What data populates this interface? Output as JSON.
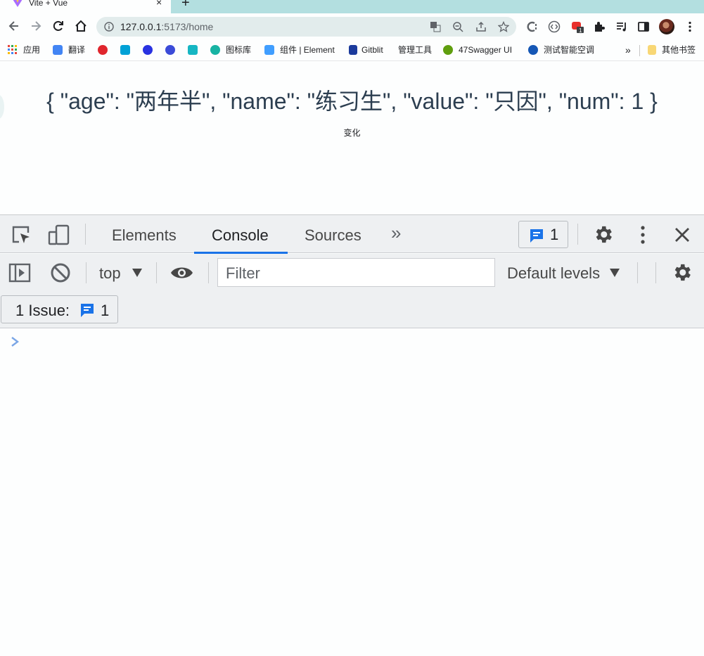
{
  "browser": {
    "tab": {
      "title": "Vite + Vue",
      "close": "×"
    },
    "new_tab": "+",
    "url": {
      "host": "127.0.0.1",
      "path": ":5173/home"
    }
  },
  "bookmarks": [
    {
      "label": "应用",
      "icon": "apps-grid-icon",
      "color": "#e8453c"
    },
    {
      "label": "翻译",
      "icon": "translate-icon",
      "color": "#4285f4"
    },
    {
      "label": "",
      "icon": "g-logo-icon",
      "color": "#e0262d"
    },
    {
      "label": "",
      "icon": "bilibili-icon",
      "color": "#00a1d6"
    },
    {
      "label": "",
      "icon": "baidu-paw-icon",
      "color": "#2932e1"
    },
    {
      "label": "",
      "icon": "search-q-icon",
      "color": "#3b4bd8"
    },
    {
      "label": "",
      "icon": "hex-logo-icon",
      "color": "#16b6c3"
    },
    {
      "label": "图标库",
      "icon": "iconfont-icon",
      "color": "#17b3a3"
    },
    {
      "label": "组件 | Element",
      "icon": "element-icon",
      "color": "#409eff"
    },
    {
      "label": "Gitblit",
      "icon": "gitblit-icon",
      "color": "#1b3a9c"
    },
    {
      "label": "管理工具",
      "icon": "",
      "color": ""
    },
    {
      "label": "47Swagger UI",
      "icon": "swagger-icon",
      "color": "#5f9e0e"
    },
    {
      "label": "测试智能空调",
      "icon": "leaf-icon",
      "color": "#1557b5"
    }
  ],
  "bookmarks_more": "»",
  "other_bookmarks": "其他书签",
  "page": {
    "json_text": "{ \"age\": \"两年半\", \"name\": \"练习生\", \"value\": \"只因\", \"num\": 1 }",
    "button_label": "变化"
  },
  "devtools": {
    "tabs": [
      "Elements",
      "Console",
      "Sources"
    ],
    "active_tab": "Console",
    "more_tabs": "»",
    "issues_count": "1",
    "context": "top",
    "filter_placeholder": "Filter",
    "levels": "Default levels",
    "issues_label": "1 Issue:",
    "issue_chip_count": "1"
  },
  "colors": {
    "tab_strip": "#b3dfe0",
    "accent": "#1a73e8",
    "text": "#2c3e50"
  }
}
